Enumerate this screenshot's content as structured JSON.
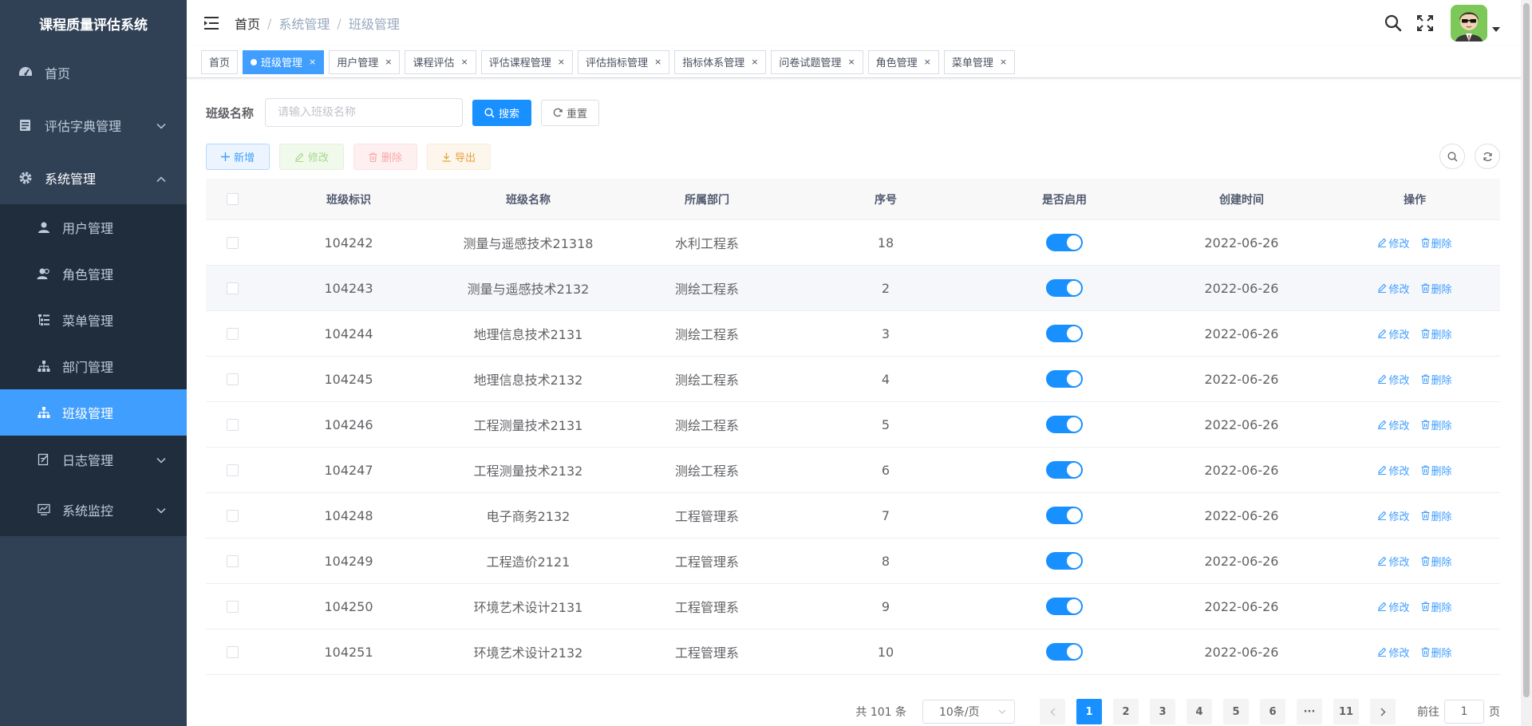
{
  "app": {
    "title": "课程质量评估系统"
  },
  "colors": {
    "sidebar_bg": "#304156",
    "submenu_bg": "#1f2d3d",
    "accent": "#409eff",
    "primary_button": "#1890ff"
  },
  "sidebar": {
    "items": [
      {
        "label": "首页",
        "icon": "dashboard-icon"
      },
      {
        "label": "评估字典管理",
        "icon": "dict-icon"
      },
      {
        "label": "系统管理",
        "icon": "gear-icon"
      }
    ],
    "sub_items": [
      {
        "label": "用户管理",
        "icon": "user-icon"
      },
      {
        "label": "角色管理",
        "icon": "peoples-icon"
      },
      {
        "label": "菜单管理",
        "icon": "tree-table-icon"
      },
      {
        "label": "部门管理",
        "icon": "tree-icon"
      },
      {
        "label": "班级管理",
        "icon": "tree-icon"
      },
      {
        "label": "日志管理",
        "icon": "log-icon"
      },
      {
        "label": "系统监控",
        "icon": "monitor-icon"
      }
    ]
  },
  "header": {
    "breadcrumb": [
      "首页",
      "系统管理",
      "班级管理"
    ],
    "separator": "/"
  },
  "tags": [
    {
      "label": "首页",
      "closable": false,
      "active": false
    },
    {
      "label": "班级管理",
      "closable": true,
      "active": true
    },
    {
      "label": "用户管理",
      "closable": true,
      "active": false
    },
    {
      "label": "课程评估",
      "closable": true,
      "active": false
    },
    {
      "label": "评估课程管理",
      "closable": true,
      "active": false
    },
    {
      "label": "评估指标管理",
      "closable": true,
      "active": false
    },
    {
      "label": "指标体系管理",
      "closable": true,
      "active": false
    },
    {
      "label": "问卷试题管理",
      "closable": true,
      "active": false
    },
    {
      "label": "角色管理",
      "closable": true,
      "active": false
    },
    {
      "label": "菜单管理",
      "closable": true,
      "active": false
    }
  ],
  "tag_close": "×",
  "search": {
    "label": "班级名称",
    "placeholder": "请输入班级名称",
    "value": "",
    "search_btn": "搜索",
    "reset_btn": "重置"
  },
  "toolbar": {
    "add": "新增",
    "edit": "修改",
    "delete": "删除",
    "export": "导出"
  },
  "table": {
    "headers": [
      "班级标识",
      "班级名称",
      "所属部门",
      "序号",
      "是否启用",
      "创建时间",
      "操作"
    ],
    "rows": [
      {
        "id": "104242",
        "name": "测量与遥感技术21318",
        "dept": "水利工程系",
        "order": "18",
        "enabled": true,
        "created": "2022-06-26"
      },
      {
        "id": "104243",
        "name": "测量与遥感技术2132",
        "dept": "测绘工程系",
        "order": "2",
        "enabled": true,
        "created": "2022-06-26"
      },
      {
        "id": "104244",
        "name": "地理信息技术2131",
        "dept": "测绘工程系",
        "order": "3",
        "enabled": true,
        "created": "2022-06-26"
      },
      {
        "id": "104245",
        "name": "地理信息技术2132",
        "dept": "测绘工程系",
        "order": "4",
        "enabled": true,
        "created": "2022-06-26"
      },
      {
        "id": "104246",
        "name": "工程测量技术2131",
        "dept": "测绘工程系",
        "order": "5",
        "enabled": true,
        "created": "2022-06-26"
      },
      {
        "id": "104247",
        "name": "工程测量技术2132",
        "dept": "测绘工程系",
        "order": "6",
        "enabled": true,
        "created": "2022-06-26"
      },
      {
        "id": "104248",
        "name": "电子商务2132",
        "dept": "工程管理系",
        "order": "7",
        "enabled": true,
        "created": "2022-06-26"
      },
      {
        "id": "104249",
        "name": "工程造价2121",
        "dept": "工程管理系",
        "order": "8",
        "enabled": true,
        "created": "2022-06-26"
      },
      {
        "id": "104250",
        "name": "环境艺术设计2131",
        "dept": "工程管理系",
        "order": "9",
        "enabled": true,
        "created": "2022-06-26"
      },
      {
        "id": "104251",
        "name": "环境艺术设计2132",
        "dept": "工程管理系",
        "order": "10",
        "enabled": true,
        "created": "2022-06-26"
      }
    ],
    "row_edit": "修改",
    "row_delete": "删除"
  },
  "pagination": {
    "total_text": "共 101 条",
    "page_size": "10条/页",
    "pages": [
      "1",
      "2",
      "3",
      "4",
      "5",
      "6",
      "···",
      "11"
    ],
    "current": "1",
    "goto_label": "前往",
    "goto_value": "1",
    "page_suffix": "页"
  }
}
